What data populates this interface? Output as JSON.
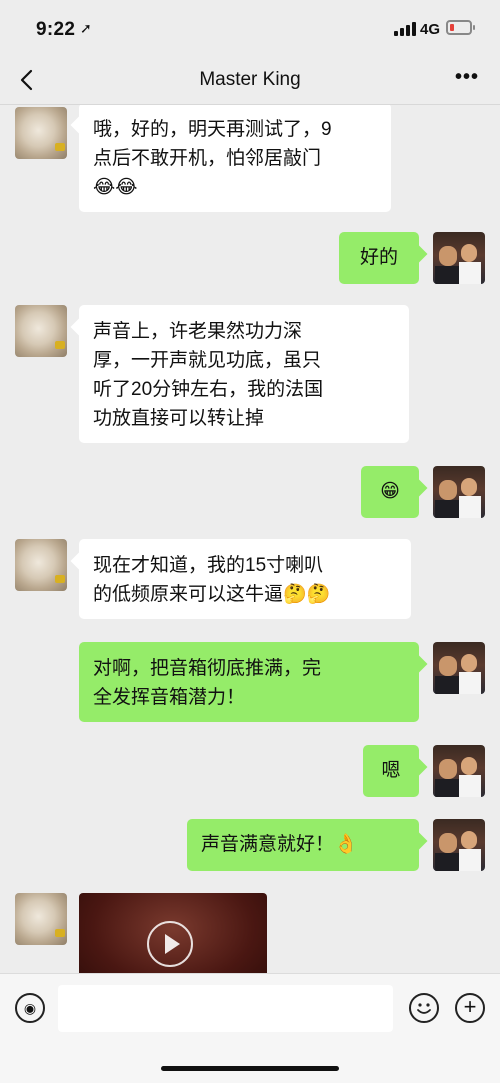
{
  "status_bar": {
    "time": "9:22",
    "network": "4G",
    "battery_color": "#e5413a"
  },
  "header": {
    "title": "Master King",
    "back_icon": "chevron-left-icon",
    "more_icon": "more-icon"
  },
  "messages": [
    {
      "sender": "them",
      "text": "哦，好的，明天再测试了，9\n点后不敢开机，怕邻居敲门\n😂😂"
    },
    {
      "sender": "me",
      "text": "好的"
    },
    {
      "sender": "them",
      "text": "声音上，许老果然功力深\n厚，一开声就见功底，虽只\n听了20分钟左右，我的法国\n功放直接可以转让掉"
    },
    {
      "sender": "me",
      "text": "😁"
    },
    {
      "sender": "them",
      "text": "现在才知道，我的15寸喇叭\n的低频原来可以这牛逼🤔🤔"
    },
    {
      "sender": "me",
      "text": "对啊，把音箱彻底推满，完\n全发挥音箱潜力！"
    },
    {
      "sender": "me",
      "text": "嗯"
    },
    {
      "sender": "me",
      "text": "声音满意就好！👌"
    },
    {
      "sender": "them",
      "type": "video"
    }
  ],
  "input_bar": {
    "value": "",
    "voice_icon": "voice-icon",
    "emoji_icon": "emoji-icon",
    "plus_icon": "plus-icon"
  },
  "colors": {
    "background": "#ededed",
    "my_bubble": "#95ec69",
    "their_bubble": "#ffffff"
  }
}
